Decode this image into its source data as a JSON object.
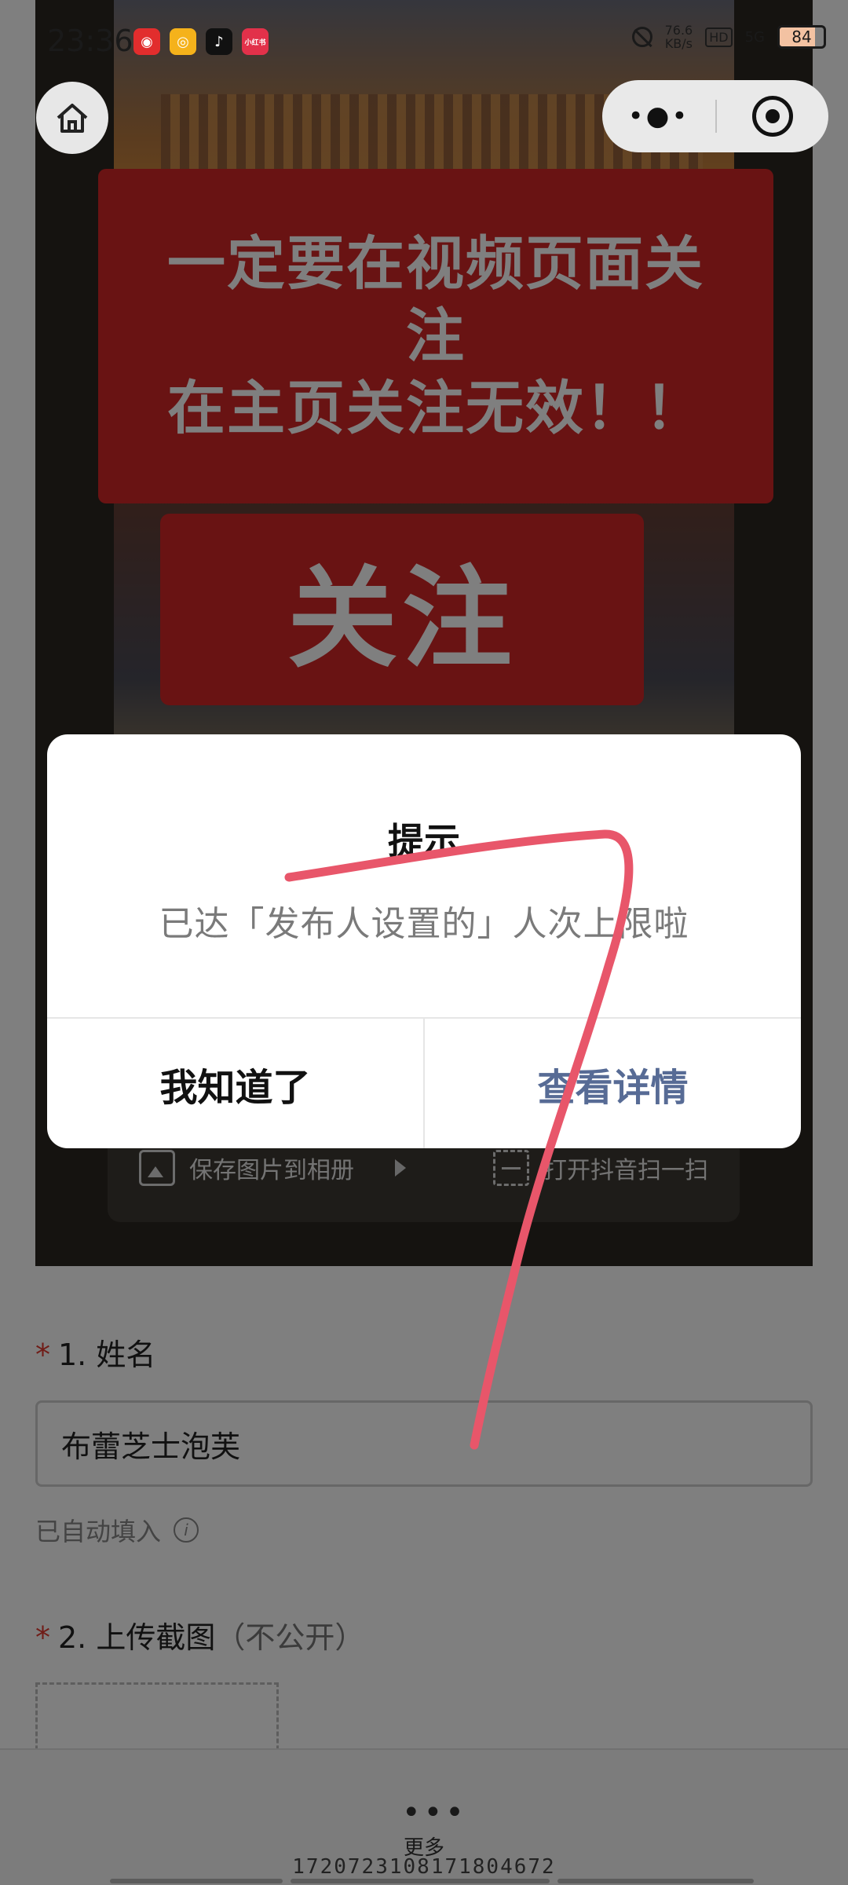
{
  "status_bar": {
    "time": "23:36",
    "app_icons": [
      "netease-music-icon",
      "weibo-icon",
      "douyin-icon",
      "xiaohongshu-icon"
    ],
    "app_icon_label": "小红书",
    "net_speed_value": "76.6",
    "net_speed_unit": "KB/s",
    "hd_label": "HD",
    "network": "5G",
    "battery": "84"
  },
  "media": {
    "banner_notice": "一定要在视频页面关\n注\n在主页关注无效！！",
    "banner_follow": "关注",
    "save_image_label": "保存图片到相册",
    "open_scan_label": "打开抖音扫一扫"
  },
  "form": {
    "q1_number": "1.",
    "q1_label": "姓名",
    "name_value": "布蕾芝士泡芙",
    "autofill_note": "已自动填入",
    "q2_number": "2.",
    "q2_label": "上传截图",
    "q2_note": "（不公开）"
  },
  "dialog": {
    "title": "提示",
    "message": "已达「发布人设置的」人次上限啦",
    "left_button": "我知道了",
    "right_button": "查看详情"
  },
  "bottom_bar": {
    "more_dots": "•••",
    "more_label": "更多",
    "id_text": "1720723108171804672"
  },
  "colors": {
    "banner_red": "#d22626",
    "link_blue": "#576b95",
    "required_star": "#e0382e",
    "annotation_stroke": "#e8566a"
  }
}
